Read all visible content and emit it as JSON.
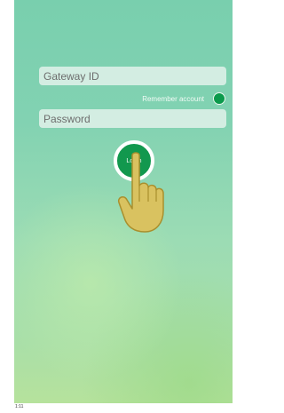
{
  "form": {
    "gateway_placeholder": "Gateway ID",
    "remember_label": "Remember account",
    "password_placeholder": "Password",
    "login_label": "Login"
  },
  "overlay": {
    "icon": "pointing-hand-icon"
  },
  "status": {
    "text": "1:11"
  },
  "colors": {
    "accent": "#12984e",
    "toggle": "#0b9a4c",
    "hand": "#d9c260"
  }
}
